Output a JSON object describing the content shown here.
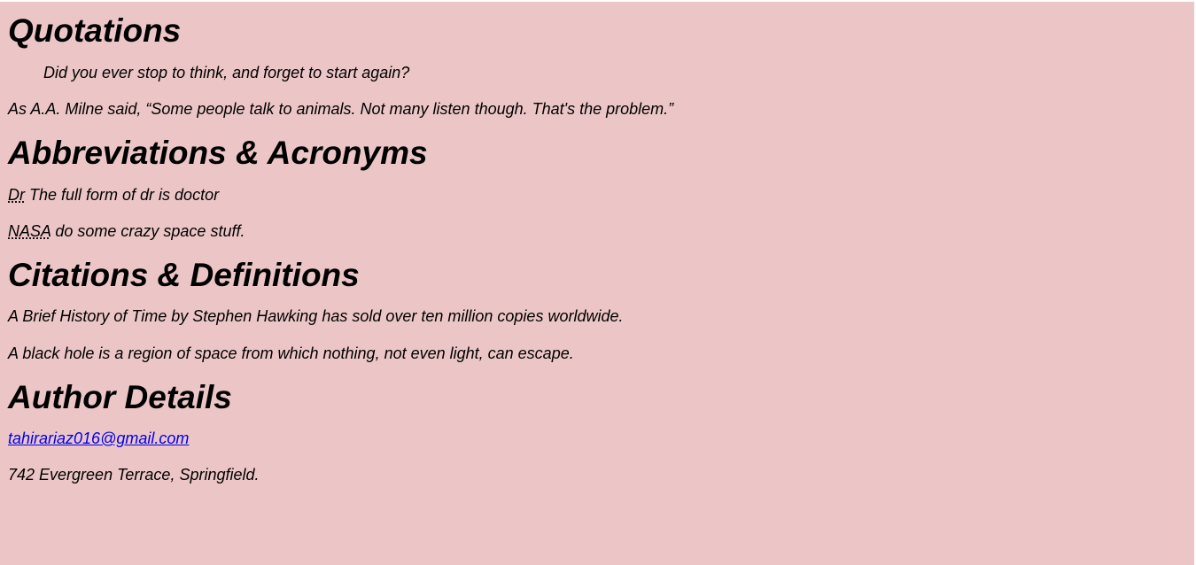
{
  "quotations": {
    "heading": "Quotations",
    "blockquote": "Did you ever stop to think, and forget to start again?",
    "inline_prefix": "As A.A. Milne said, ",
    "inline_quote": "Some people talk to animals. Not many listen though. That's the problem."
  },
  "abbreviations": {
    "heading": "Abbreviations & Acronyms",
    "items": [
      {
        "abbr": "Dr",
        "text": " The full form of dr is doctor"
      },
      {
        "abbr": "NASA",
        "text": " do some crazy space stuff."
      }
    ]
  },
  "citations": {
    "heading": "Citations & Definitions",
    "citation": "A Brief History of Time by Stephen Hawking has sold over ten million copies worldwide.",
    "definition": "A black hole is a region of space from which nothing, not even light, can escape."
  },
  "author": {
    "heading": "Author Details",
    "email": "tahirariaz016@gmail.com",
    "address": "742 Evergreen Terrace, Springfield."
  },
  "colors": {
    "background": "#ecc6c7",
    "link": "#0000ee",
    "text": "#000000"
  }
}
